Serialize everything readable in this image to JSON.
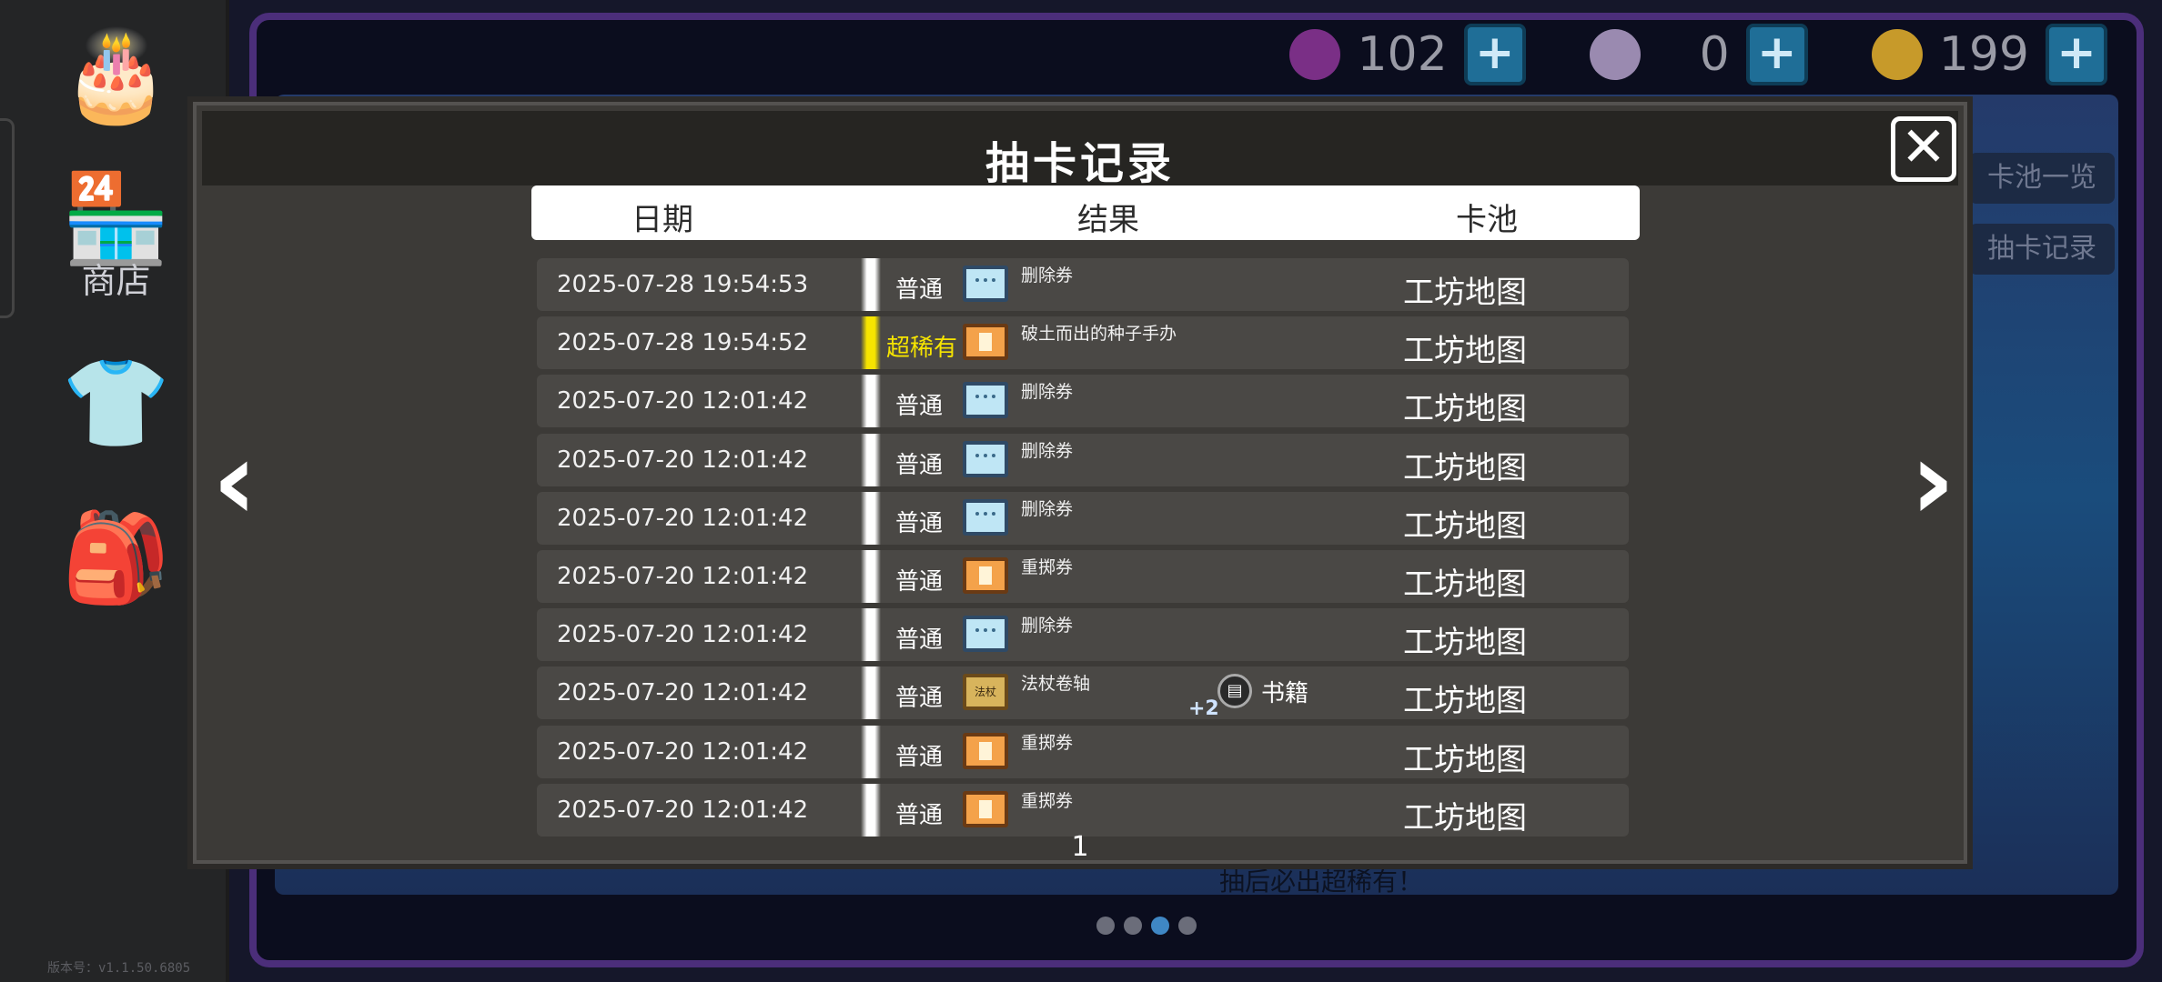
{
  "app": {
    "version": "版本号：v1.1.50.6805"
  },
  "sidebar": {
    "shop_label": "商店",
    "icons": [
      "cake-icon",
      "shop-icon",
      "tshirt-icon",
      "backpack-icon"
    ]
  },
  "currencies": [
    {
      "name": "gem",
      "value": "102",
      "color": "#7a2f86"
    },
    {
      "name": "orb",
      "value": "0",
      "color": "#9a8ab0"
    },
    {
      "name": "coin",
      "value": "199",
      "color": "#c79a2a"
    }
  ],
  "right_tabs": [
    "卡池一览",
    "抽卡记录"
  ],
  "hint_text": "抽后必出超稀有！",
  "modal": {
    "title": "抽卡记录",
    "columns": {
      "date": "日期",
      "result": "结果",
      "pool": "卡池"
    },
    "page": "1",
    "rows": [
      {
        "date": "2025-07-28 19:54:53",
        "rarity": "普通",
        "rarity_color": "#ffffff",
        "icon": "delete-ticket-icon",
        "item": "删除券",
        "pool": "工坊地图"
      },
      {
        "date": "2025-07-28 19:54:52",
        "rarity": "超稀有",
        "rarity_color": "#f6e400",
        "icon": "reroll-ticket-icon",
        "item": "破土而出的种子手办",
        "pool": "工坊地图"
      },
      {
        "date": "2025-07-20 12:01:42",
        "rarity": "普通",
        "rarity_color": "#ffffff",
        "icon": "delete-ticket-icon",
        "item": "删除券",
        "pool": "工坊地图"
      },
      {
        "date": "2025-07-20 12:01:42",
        "rarity": "普通",
        "rarity_color": "#ffffff",
        "icon": "delete-ticket-icon",
        "item": "删除券",
        "pool": "工坊地图"
      },
      {
        "date": "2025-07-20 12:01:42",
        "rarity": "普通",
        "rarity_color": "#ffffff",
        "icon": "delete-ticket-icon",
        "item": "删除券",
        "pool": "工坊地图"
      },
      {
        "date": "2025-07-20 12:01:42",
        "rarity": "普通",
        "rarity_color": "#ffffff",
        "icon": "reroll-ticket-icon",
        "item": "重掷券",
        "pool": "工坊地图"
      },
      {
        "date": "2025-07-20 12:01:42",
        "rarity": "普通",
        "rarity_color": "#ffffff",
        "icon": "delete-ticket-icon",
        "item": "删除券",
        "pool": "工坊地图"
      },
      {
        "date": "2025-07-20 12:01:42",
        "rarity": "普通",
        "rarity_color": "#ffffff",
        "icon": "scroll-icon",
        "item": "法杖卷轴",
        "icon_text": "法杖",
        "extra_label": "书籍",
        "extra_count": "+2",
        "pool": "工坊地图"
      },
      {
        "date": "2025-07-20 12:01:42",
        "rarity": "普通",
        "rarity_color": "#ffffff",
        "icon": "reroll-ticket-icon",
        "item": "重掷券",
        "pool": "工坊地图"
      },
      {
        "date": "2025-07-20 12:01:42",
        "rarity": "普通",
        "rarity_color": "#ffffff",
        "icon": "reroll-ticket-icon",
        "item": "重掷券",
        "pool": "工坊地图"
      }
    ]
  },
  "carousel": {
    "count": 4,
    "active_index": 2
  }
}
